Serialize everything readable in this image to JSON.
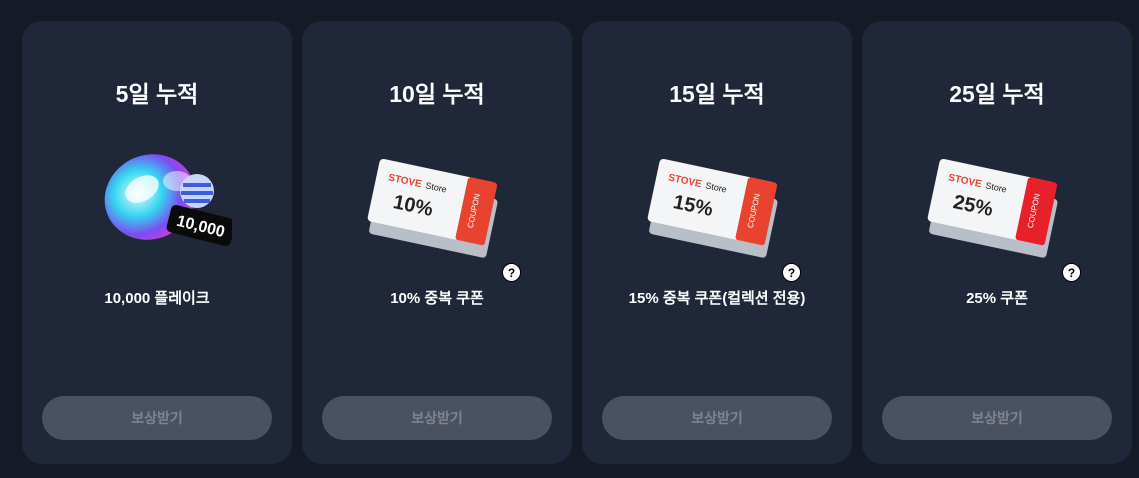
{
  "cards": [
    {
      "title": "5일 누적",
      "reward": "10,000 플레이크",
      "badge": "10,000",
      "button": "보상받기",
      "has_help": false
    },
    {
      "title": "10일 누적",
      "reward": "10% 중복 쿠폰",
      "coupon_brand": "STOVE",
      "coupon_store": "Store",
      "coupon_value": "10%",
      "coupon_tag": "COUPON",
      "button": "보상받기",
      "has_help": true
    },
    {
      "title": "15일 누적",
      "reward": "15% 중복 쿠폰(컬렉션 전용)",
      "coupon_brand": "STOVE",
      "coupon_store": "Store",
      "coupon_value": "15%",
      "coupon_tag": "COUPON",
      "button": "보상받기",
      "has_help": true
    },
    {
      "title": "25일 누적",
      "reward": "25% 쿠폰",
      "coupon_brand": "STOVE",
      "coupon_store": "Store",
      "coupon_value": "25%",
      "coupon_tag": "COUPON",
      "button": "보상받기",
      "has_help": true
    }
  ],
  "help_glyph": "?",
  "colors": {
    "page_bg": "#151b26",
    "card_bg": "#1f2738",
    "button_bg": "#4a5160",
    "button_text": "#7e8591",
    "coupon_red": "#e8432f",
    "brand_red": "#e8432f"
  }
}
